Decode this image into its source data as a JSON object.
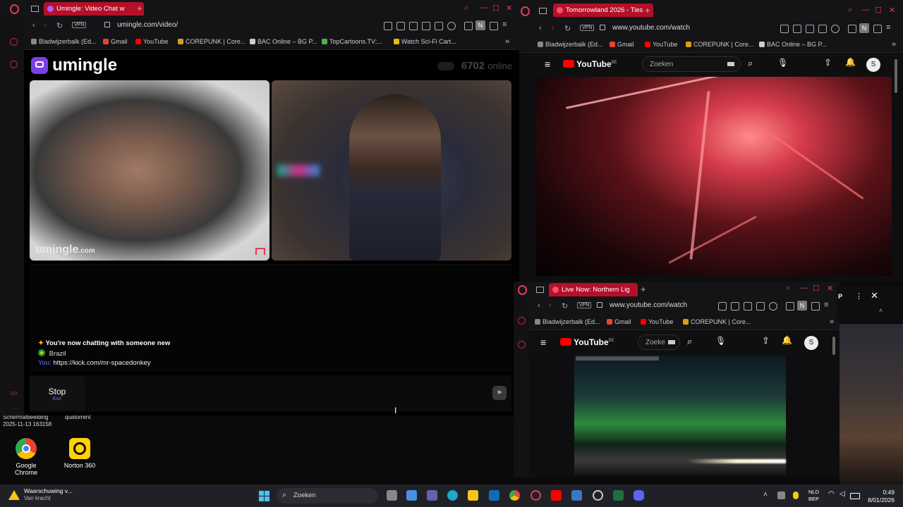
{
  "desktop": {
    "screenshot_label": "Schermafbeelding",
    "screenshot_date": "2025-11-13 163158",
    "folder_label": "quatorrent",
    "icons": [
      {
        "label": "Google Chrome",
        "icon": "chrome-icon"
      },
      {
        "label": "Norton 360",
        "icon": "norton-icon"
      }
    ]
  },
  "left_browser": {
    "tab_title": "Umingle: Video Chat w",
    "url": "umingle.com/video/",
    "vpn": "VPN",
    "bookmarks": [
      "Bladwijzerbalk (Ed...",
      "Gmail",
      "YouTube",
      "COREPUNK | Core...",
      "BAC Online – BG P...",
      "TopCartoons.TV:...",
      "Watch Sci-Fi Cart..."
    ]
  },
  "umingle": {
    "logo": "umingle",
    "online_count": "6702",
    "online_label": "online",
    "watermark": "umingle",
    "watermark_suffix": ".com",
    "chat": {
      "system_msg": "You're now chatting with someone new",
      "country": "Brazil",
      "you_label": "You:",
      "you_msg": "https://kick.com/mr-spacedonkey"
    },
    "stop_label": "Stop",
    "stop_hint": "Esc",
    "input_placeholder": ""
  },
  "right_top_browser": {
    "tab_title": "Tomorrowland 2026 - Ties",
    "url": "www.youtube.com/watch",
    "vpn": "VPN",
    "bookmarks": [
      "Bladwijzerbalk (Ed...",
      "Gmail",
      "YouTube",
      "COREPUNK | Core...",
      "BAC Online – BG P..."
    ],
    "yt_logo": "YouTube",
    "yt_region": "BE",
    "search_placeholder": "Zoeken",
    "avatar": "S"
  },
  "right_bottom_browser": {
    "tab_title": "Live Now: Northern Lig",
    "url": "www.youtube.com/watch",
    "vpn": "VPN",
    "bookmarks": [
      "Bladwijzerbalk (Ed...",
      "Gmail",
      "YouTube",
      "COREPUNK | Core..."
    ],
    "yt_logo": "YouTube",
    "yt_region": "BE",
    "search_placeholder": "Zoeke",
    "avatar": "S",
    "overlay_tag": "P"
  },
  "taskbar": {
    "notification_title": "Waarschuwing v...",
    "notification_sub": "Van kracht",
    "search_placeholder": "Zoeken",
    "lang_top": "NLD",
    "lang_bottom": "BEP",
    "time": "0:49",
    "date": "8/01/2026"
  },
  "colors": {
    "opera_red": "#c0243e",
    "umingle_purple": "#7b3fe4",
    "youtube_red": "#ff0000",
    "chat_link": "#5b7cff"
  }
}
